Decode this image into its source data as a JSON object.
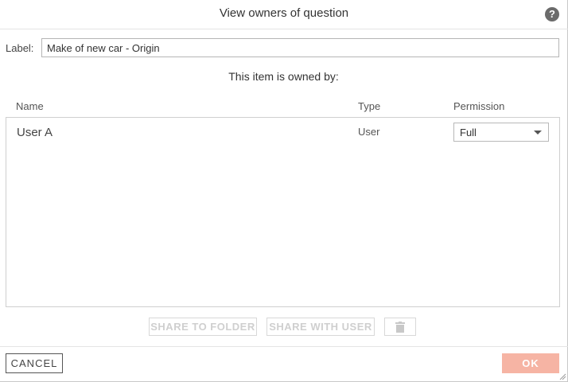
{
  "dialog": {
    "title": "View owners of question",
    "help_icon": "help-icon",
    "help_glyph": "?"
  },
  "label": {
    "text": "Label:",
    "value": "Make of new car - Origin"
  },
  "owned_by_text": "This item is owned by:",
  "table": {
    "columns": [
      "Name",
      "Type",
      "Permission"
    ],
    "rows": [
      {
        "name": "User A",
        "type": "User",
        "permission": "Full"
      }
    ]
  },
  "actions": {
    "share_to_folder": "SHARE TO FOLDER",
    "share_with_user": "SHARE WITH USER",
    "delete_icon": "trash-icon"
  },
  "footer": {
    "cancel": "CANCEL",
    "ok": "OK"
  },
  "colors": {
    "ok_button": "#f6b4a4",
    "disabled_text": "#cfcfcf",
    "help_icon": "#6b6b6b"
  }
}
